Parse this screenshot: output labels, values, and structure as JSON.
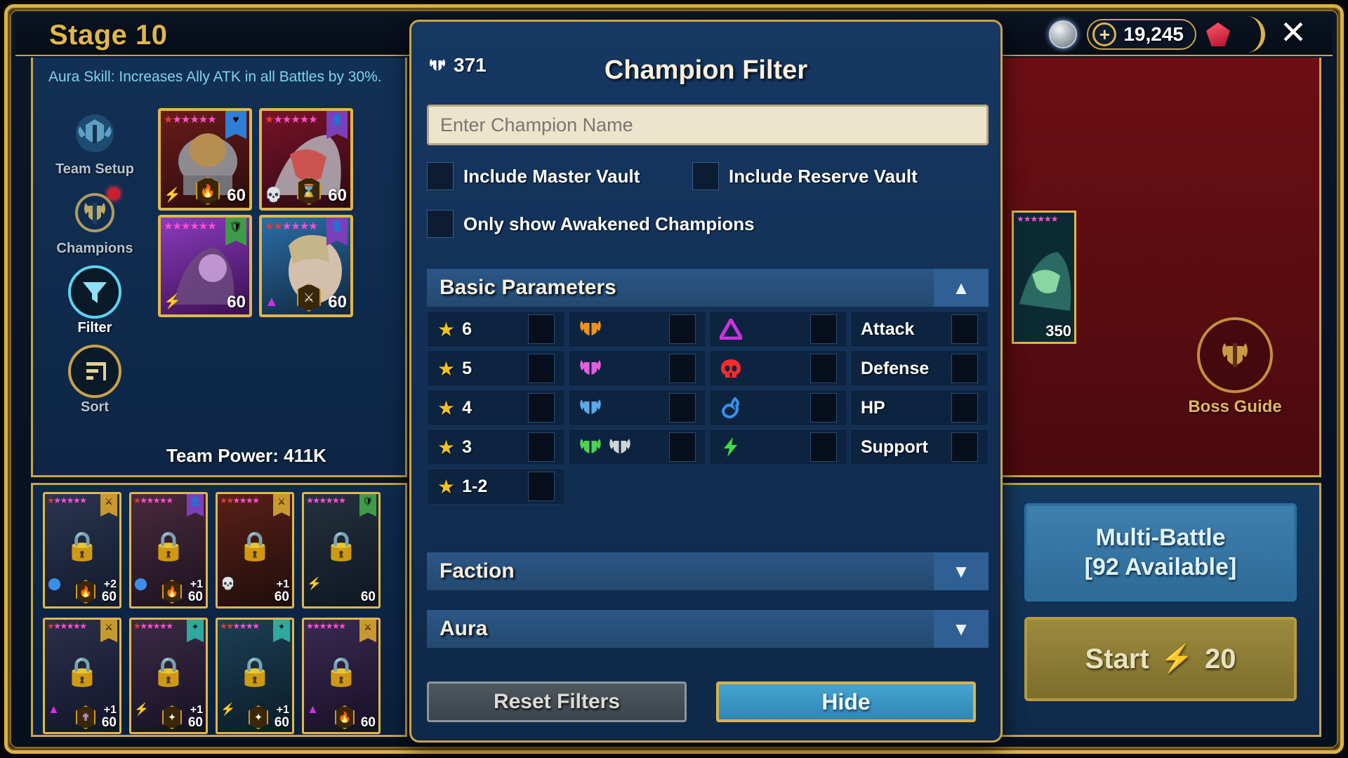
{
  "topbar": {
    "stage_title": "Stage 10",
    "coin_icon": "silver-coin-icon",
    "energy_currency": "19,245",
    "plus_label": "+",
    "gem_icon": "gem-icon",
    "close_label": "✕"
  },
  "left_panel": {
    "aura_skill": "Aura Skill: Increases Ally ATK in all Battles by 30%.",
    "team_power": "Team Power: 411K",
    "nav": [
      {
        "label": "Team Setup",
        "icon": "team-setup-helm-icon",
        "active": false
      },
      {
        "label": "Champions",
        "icon": "champions-helm-icon",
        "active": false,
        "notification": true
      },
      {
        "label": "Filter",
        "icon": "filter-funnel-icon",
        "active": true
      },
      {
        "label": "Sort",
        "icon": "sort-bars-icon",
        "active": false
      }
    ],
    "team_cards": [
      {
        "stars": "★★★★★★",
        "star_colors": [
          "#e23b3b",
          "#ff4fd2",
          "#ff4fd2",
          "#ff4fd2",
          "#ff4fd2",
          "#ff4fd2"
        ],
        "level": "60",
        "affinity": "force-bolt",
        "role": "hp",
        "role_color": "#2f7fd6",
        "gear": "🔥",
        "art": "helmet"
      },
      {
        "stars": "★★★★★★",
        "star_colors": [
          "#e23b3b",
          "#ff4fd2",
          "#ff4fd2",
          "#ff4fd2",
          "#ff4fd2",
          "#ff4fd2"
        ],
        "level": "60",
        "affinity": "spirit-skull",
        "role": "support",
        "role_color": "#7b3fba",
        "gear": "⌛",
        "art": "dragon"
      },
      {
        "stars": "★★★★★★",
        "star_colors": [
          "#ff4fd2",
          "#ff4fd2",
          "#ff4fd2",
          "#ff4fd2",
          "#ff4fd2",
          "#ff4fd2"
        ],
        "level": "60",
        "affinity": "force-bolt",
        "role": "defense",
        "role_color": "#3f9b4a",
        "gear": "",
        "art": "purple-beast"
      },
      {
        "stars": "★★★★★★",
        "star_colors": [
          "#e23b3b",
          "#e23b3b",
          "#ff4fd2",
          "#ff4fd2",
          "#ff4fd2",
          "#ff4fd2"
        ],
        "level": "60",
        "affinity": "magic-triangle",
        "role": "support",
        "role_color": "#7b3fba",
        "gear": "⚔",
        "art": "woman"
      }
    ],
    "roster": [
      {
        "stars": "★★★★★★",
        "plus": "+2",
        "level": "60",
        "affinity": "force-bolt",
        "role_color": "#c8992f",
        "locked": true
      },
      {
        "stars": "★★★★★★",
        "plus": "+1",
        "level": "60",
        "affinity": "force-bolt",
        "role_color": "#7b3fba",
        "locked": true
      },
      {
        "stars": "★★★★★★",
        "plus": "+1",
        "level": "60",
        "affinity": "spirit-skull",
        "role_color": "#c8992f",
        "locked": true
      },
      {
        "stars": "★★★★★★",
        "plus": "",
        "level": "60",
        "affinity": "void-bolt",
        "role_color": "#3f9b4a",
        "locked": true
      },
      {
        "stars": "★★★★★★",
        "plus": "+1",
        "level": "60",
        "affinity": "magic-triangle",
        "role_color": "#c8992f",
        "locked": true
      },
      {
        "stars": "★★★★★★",
        "plus": "+1",
        "level": "60",
        "affinity": "void-bolt",
        "role_color": "#2fa8a0",
        "locked": true
      },
      {
        "stars": "★★★★★★",
        "plus": "+1",
        "level": "60",
        "affinity": "void-bolt",
        "role_color": "#2fa8a0",
        "locked": true
      },
      {
        "stars": "★★★★★★",
        "plus": "",
        "level": "60",
        "affinity": "magic-triangle",
        "role_color": "#c8992f",
        "locked": true
      }
    ]
  },
  "right_panel": {
    "boss_level": "350",
    "boss_stars": "★★★★★★",
    "boss_guide_label": "Boss Guide",
    "multi_battle_line1": "Multi-Battle",
    "multi_battle_line2": "[92 Available]",
    "start_label": "Start",
    "start_cost": "20",
    "start_bolt": "⚡"
  },
  "modal": {
    "title": "Champion Filter",
    "energy_value": "371",
    "energy_icon": "helm-energy-icon",
    "search": {
      "placeholder": "Enter Champion Name",
      "value": ""
    },
    "checkboxes": [
      {
        "label": "Include Master Vault",
        "checked": false
      },
      {
        "label": "Include Reserve Vault",
        "checked": false
      },
      {
        "label": "Only show Awakened Champions",
        "checked": false
      }
    ],
    "sections": [
      {
        "title": "Basic Parameters",
        "expanded": true,
        "chevron": "▲"
      },
      {
        "title": "Faction",
        "expanded": false,
        "chevron": "▼"
      },
      {
        "title": "Aura",
        "expanded": false,
        "chevron": "▼"
      }
    ],
    "basic_parameters": {
      "rarity_column": [
        {
          "label": "6",
          "star": "★",
          "checked": false
        },
        {
          "label": "5",
          "star": "★",
          "checked": false
        },
        {
          "label": "4",
          "star": "★",
          "checked": false
        },
        {
          "label": "3",
          "star": "★",
          "checked": false
        },
        {
          "label": "1-2",
          "star": "★",
          "checked": false
        }
      ],
      "rank_column": [
        {
          "icon": "helmet-legendary-icon",
          "colors": [
            "#f0911f"
          ],
          "checked": false
        },
        {
          "icon": "helmet-epic-icon",
          "colors": [
            "#e45fe0"
          ],
          "checked": false
        },
        {
          "icon": "helmet-rare-icon",
          "colors": [
            "#5aa9e8"
          ],
          "checked": false
        },
        {
          "icon": "helmet-uncommon-common-icon",
          "colors": [
            "#4fd24f",
            "#cfd4d8"
          ],
          "checked": false
        }
      ],
      "affinity_column": [
        {
          "icon": "magic-triangle-icon",
          "color": "#cc33dd",
          "checked": false
        },
        {
          "icon": "spirit-skull-icon",
          "color": "#ff2b2b",
          "checked": false
        },
        {
          "icon": "force-flame-icon",
          "color": "#3a8fe8",
          "checked": false
        },
        {
          "icon": "void-bolt-icon",
          "color": "#3ee03e",
          "checked": false
        }
      ],
      "role_column": [
        {
          "label": "Attack",
          "checked": false
        },
        {
          "label": "Defense",
          "checked": false
        },
        {
          "label": "HP",
          "checked": false
        },
        {
          "label": "Support",
          "checked": false
        }
      ]
    },
    "buttons": {
      "reset": "Reset Filters",
      "hide": "Hide"
    }
  },
  "colors": {
    "gold": "#c9a545",
    "panel_blue": "#112d52",
    "accent_cyan": "#46a3cf",
    "star_yellow": "#f2c21c"
  }
}
